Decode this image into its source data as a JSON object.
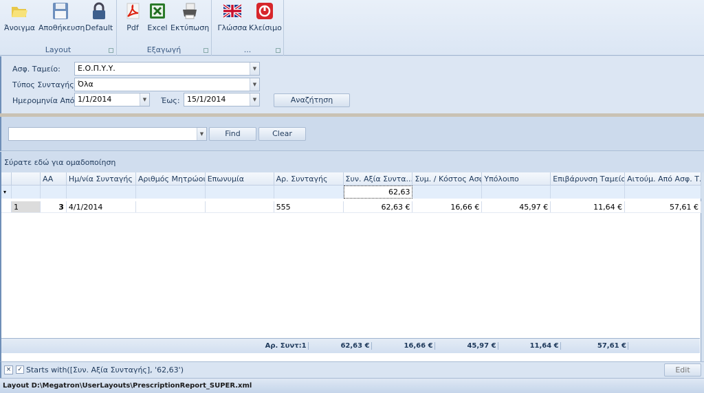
{
  "ribbon": {
    "groups": [
      {
        "label": "Layout",
        "buttons": [
          {
            "label": "Άνοιγμα",
            "icon": "folder-open-icon"
          },
          {
            "label": "Αποθήκευση",
            "icon": "floppy-save-icon"
          },
          {
            "label": "Default",
            "icon": "lock-icon"
          }
        ]
      },
      {
        "label": "Εξαγωγή",
        "buttons": [
          {
            "label": "Pdf",
            "icon": "pdf-icon"
          },
          {
            "label": "Excel",
            "icon": "excel-icon"
          },
          {
            "label": "Εκτύπωση",
            "icon": "printer-icon"
          }
        ]
      },
      {
        "label": "...",
        "buttons": [
          {
            "label": "Γλώσσα",
            "icon": "uk-flag-icon"
          },
          {
            "label": "Κλείσιμο",
            "icon": "power-icon"
          }
        ]
      }
    ]
  },
  "params": {
    "fund_label": "Ασφ. Ταμείο:",
    "fund_value": "Ε.Ο.Π.Υ.Υ.",
    "type_label": "Τύπος Συνταγής:",
    "type_value": "Όλα",
    "date_from_label": "Ημερομηνία Από:",
    "date_from": "1/1/2014",
    "date_to_label": "Έως:",
    "date_to": "15/1/2014",
    "search_button": "Αναζήτηση"
  },
  "find": {
    "value": "",
    "find_button": "Find",
    "clear_button": "Clear"
  },
  "group_panel_text": "Σύρατε εδώ για ομαδοποίηση",
  "grid": {
    "columns": [
      "",
      "AA",
      "Ημ/νία Συνταγής",
      "Αριθμός Μητρώου",
      "Επωνυμία",
      "Αρ. Συνταγής",
      "Συν. Αξία Συντα...",
      "Συμ. / Κόστος Ασφ.",
      "Υπόλοιπο",
      "Επιβάρυνση Ταμείου",
      "Αιτούμ. Από Ασφ. Τ..."
    ],
    "filter_value": "62,63",
    "rows": [
      [
        "1",
        "3",
        "4/1/2014",
        "",
        "",
        "555",
        "62,63 €",
        "16,66 €",
        "45,97 €",
        "11,64 €",
        "57,61 €"
      ]
    ],
    "footer": {
      "count": "Αρ. Συντ:1",
      "totals": [
        "62,63 €",
        "16,66 €",
        "45,97 €",
        "11,64 €",
        "57,61 €"
      ]
    }
  },
  "filter_bar": {
    "text": "Starts with([Συν. Αξία Συνταγής], '62,63')",
    "edit_button": "Edit Filter"
  },
  "status": "Layout D:\\Megatron\\UserLayouts\\PrescriptionReport_SUPER.xml"
}
